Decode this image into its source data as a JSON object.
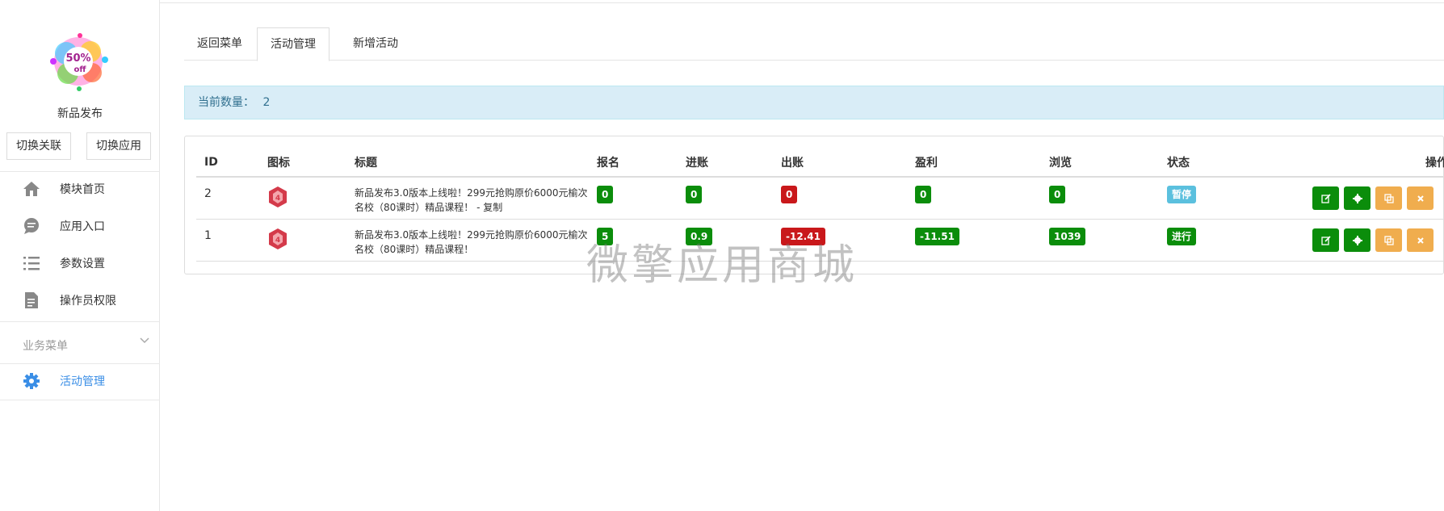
{
  "sidebar": {
    "app_name": "新品发布",
    "switch_link": "切换关联",
    "switch_app": "切换应用",
    "items": [
      {
        "label": "模块首页",
        "icon": "home-icon"
      },
      {
        "label": "应用入口",
        "icon": "chat-icon"
      },
      {
        "label": "参数设置",
        "icon": "list-icon"
      },
      {
        "label": "操作员权限",
        "icon": "document-icon"
      }
    ],
    "section_title": "业务菜单",
    "business_items": [
      {
        "label": "活动管理",
        "icon": "gear-icon"
      }
    ]
  },
  "tabs": [
    "返回菜单",
    "活动管理",
    "新增活动"
  ],
  "info": {
    "label": "当前数量：",
    "count": "2"
  },
  "table": {
    "headers": [
      "ID",
      "图标",
      "标题",
      "报名",
      "进账",
      "出账",
      "盈利",
      "浏览",
      "状态",
      "操作"
    ],
    "rows": [
      {
        "id": "2",
        "title": "新品发布3.0版本上线啦！299元抢购原价6000元榆次名校（80课时）精品课程！ - 复制",
        "signup": "0",
        "income": "0",
        "expense": "0",
        "profit": "0",
        "views": "0",
        "status": "暂停",
        "status_color": "#5bc0de"
      },
      {
        "id": "1",
        "title": "新品发布3.0版本上线啦！299元抢购原价6000元榆次名校（80课时）精品课程！",
        "signup": "5",
        "income": "0.9",
        "expense": "-12.41",
        "profit": "-11.51",
        "views": "1039",
        "status": "进行",
        "status_color": "#0b8d0b"
      }
    ]
  },
  "watermark": "微擎应用商城",
  "colors": {
    "green": "#0b8d0b",
    "red": "#c9181b",
    "cyan": "#5bc0de",
    "orange": "#f0ad4e",
    "accent": "#3a8ee6"
  }
}
